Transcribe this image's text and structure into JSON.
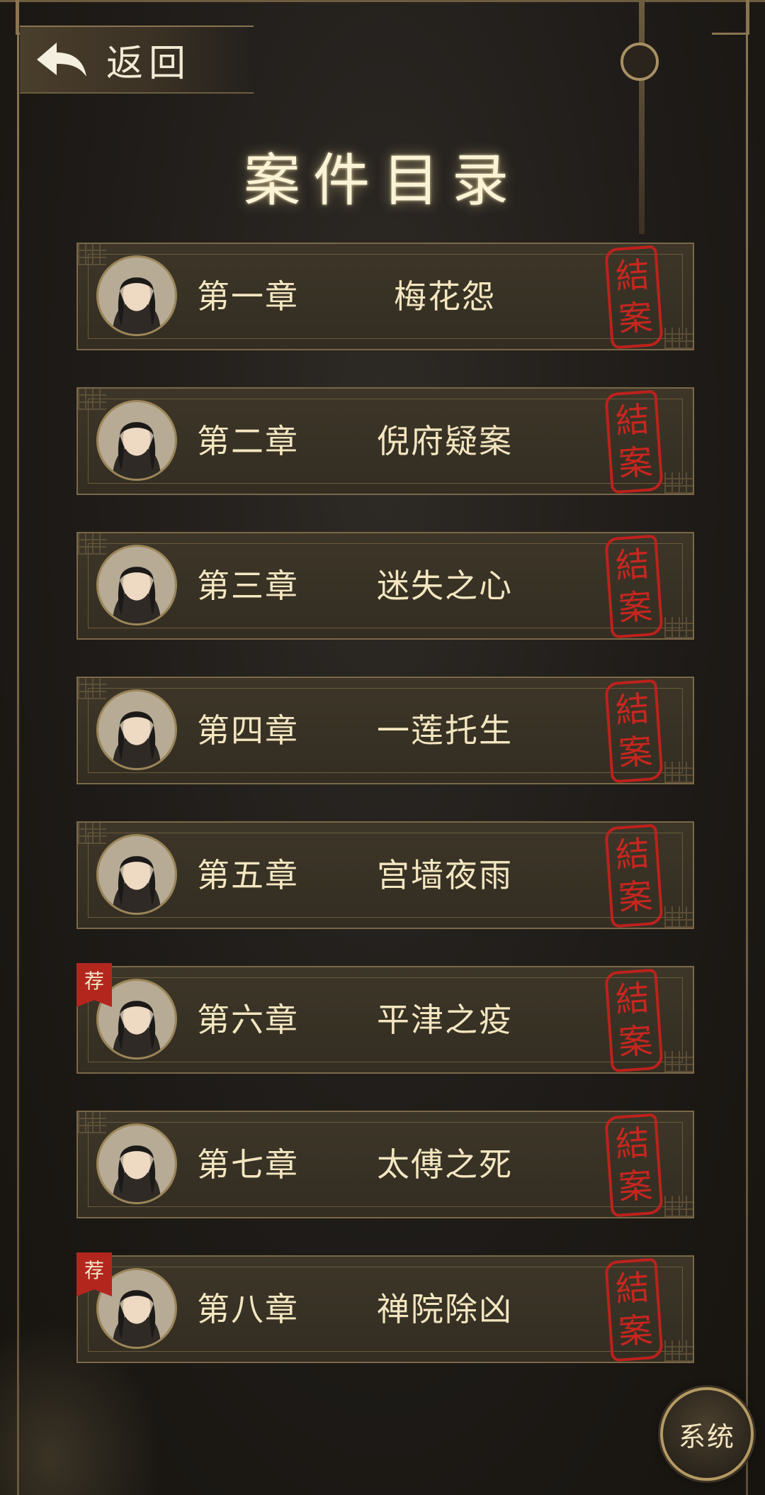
{
  "back": {
    "label": "返回"
  },
  "title": "案件目录",
  "cases": [
    {
      "chapter": "第一章",
      "name": "梅花怨",
      "seal": [
        "結",
        "案"
      ],
      "badge": ""
    },
    {
      "chapter": "第二章",
      "name": "倪府疑案",
      "seal": [
        "結",
        "案"
      ],
      "badge": ""
    },
    {
      "chapter": "第三章",
      "name": "迷失之心",
      "seal": [
        "結",
        "案"
      ],
      "badge": ""
    },
    {
      "chapter": "第四章",
      "name": "一莲托生",
      "seal": [
        "結",
        "案"
      ],
      "badge": ""
    },
    {
      "chapter": "第五章",
      "name": "宫墙夜雨",
      "seal": [
        "結",
        "案"
      ],
      "badge": ""
    },
    {
      "chapter": "第六章",
      "name": "平津之疫",
      "seal": [
        "結",
        "案"
      ],
      "badge": "荐"
    },
    {
      "chapter": "第七章",
      "name": "太傅之死",
      "seal": [
        "結",
        "案"
      ],
      "badge": ""
    },
    {
      "chapter": "第八章",
      "name": "禅院除凶",
      "seal": [
        "結",
        "案"
      ],
      "badge": "荐"
    }
  ],
  "system_button": {
    "label": "系统"
  },
  "colors": {
    "gold": "#b59a63",
    "text": "#f3e6c0",
    "seal_red": "#c9201c",
    "badge_red": "#b3261e"
  }
}
